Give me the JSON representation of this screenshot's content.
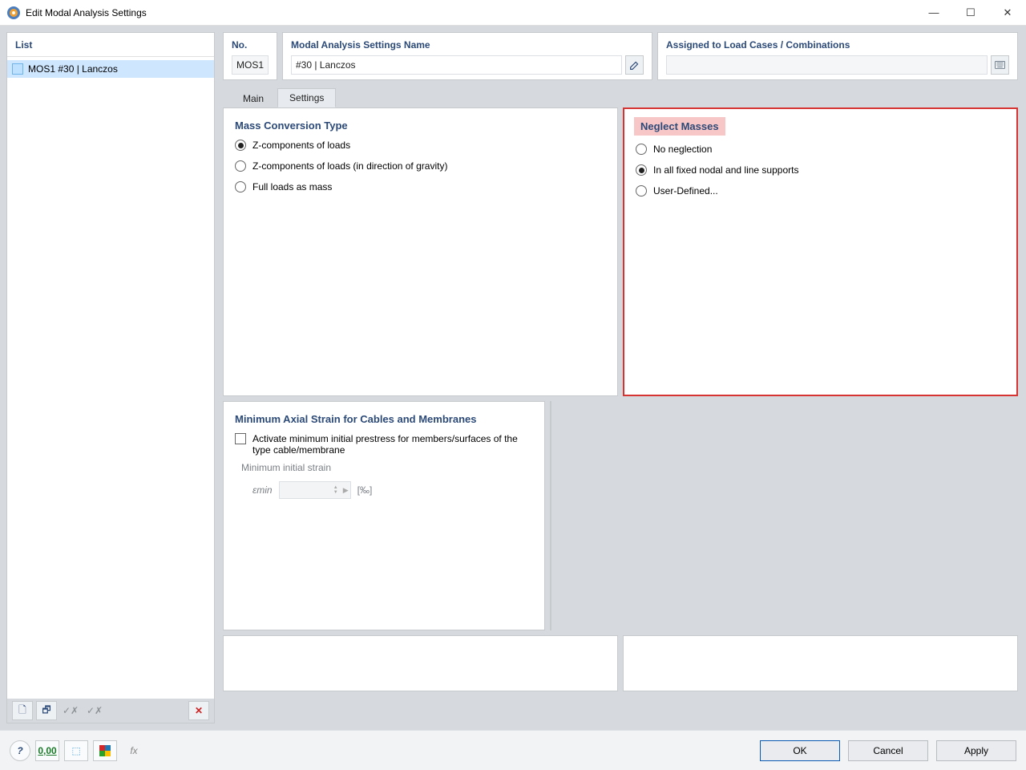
{
  "window": {
    "title": "Edit Modal Analysis Settings",
    "minimize": "—",
    "maximize": "☐",
    "close": "✕"
  },
  "sidebar": {
    "header": "List",
    "items": [
      {
        "label": "MOS1 #30 | Lanczos"
      }
    ],
    "tools": {
      "new": "🗋",
      "copy": "🗗",
      "checks1": "✓✗",
      "checks2": "✓✗",
      "delete": "✕"
    }
  },
  "header": {
    "no_label": "No.",
    "no_value": "MOS1",
    "name_label": "Modal Analysis Settings Name",
    "name_value": "#30 | Lanczos",
    "assigned_label": "Assigned to Load Cases / Combinations",
    "assigned_value": ""
  },
  "tabs": {
    "main": "Main",
    "settings": "Settings"
  },
  "mass_conversion": {
    "title": "Mass Conversion Type",
    "opt1": "Z-components of loads",
    "opt2": "Z-components of loads (in direction of gravity)",
    "opt3": "Full loads as mass"
  },
  "neglect": {
    "title": "Neglect Masses",
    "opt1": "No neglection",
    "opt2": "In all fixed nodal and line supports",
    "opt3": "User-Defined..."
  },
  "strain": {
    "title": "Minimum Axial Strain for Cables and Membranes",
    "checkbox": "Activate minimum initial prestress for members/surfaces of the type cable/membrane",
    "sublabel": "Minimum initial strain",
    "symbol": "εmin",
    "unit": "[‰]"
  },
  "bottom": {
    "help": "?",
    "units": "0,00",
    "cursor": "⬚",
    "palette": "◧",
    "fx": "fx",
    "ok": "OK",
    "cancel": "Cancel",
    "apply": "Apply"
  }
}
